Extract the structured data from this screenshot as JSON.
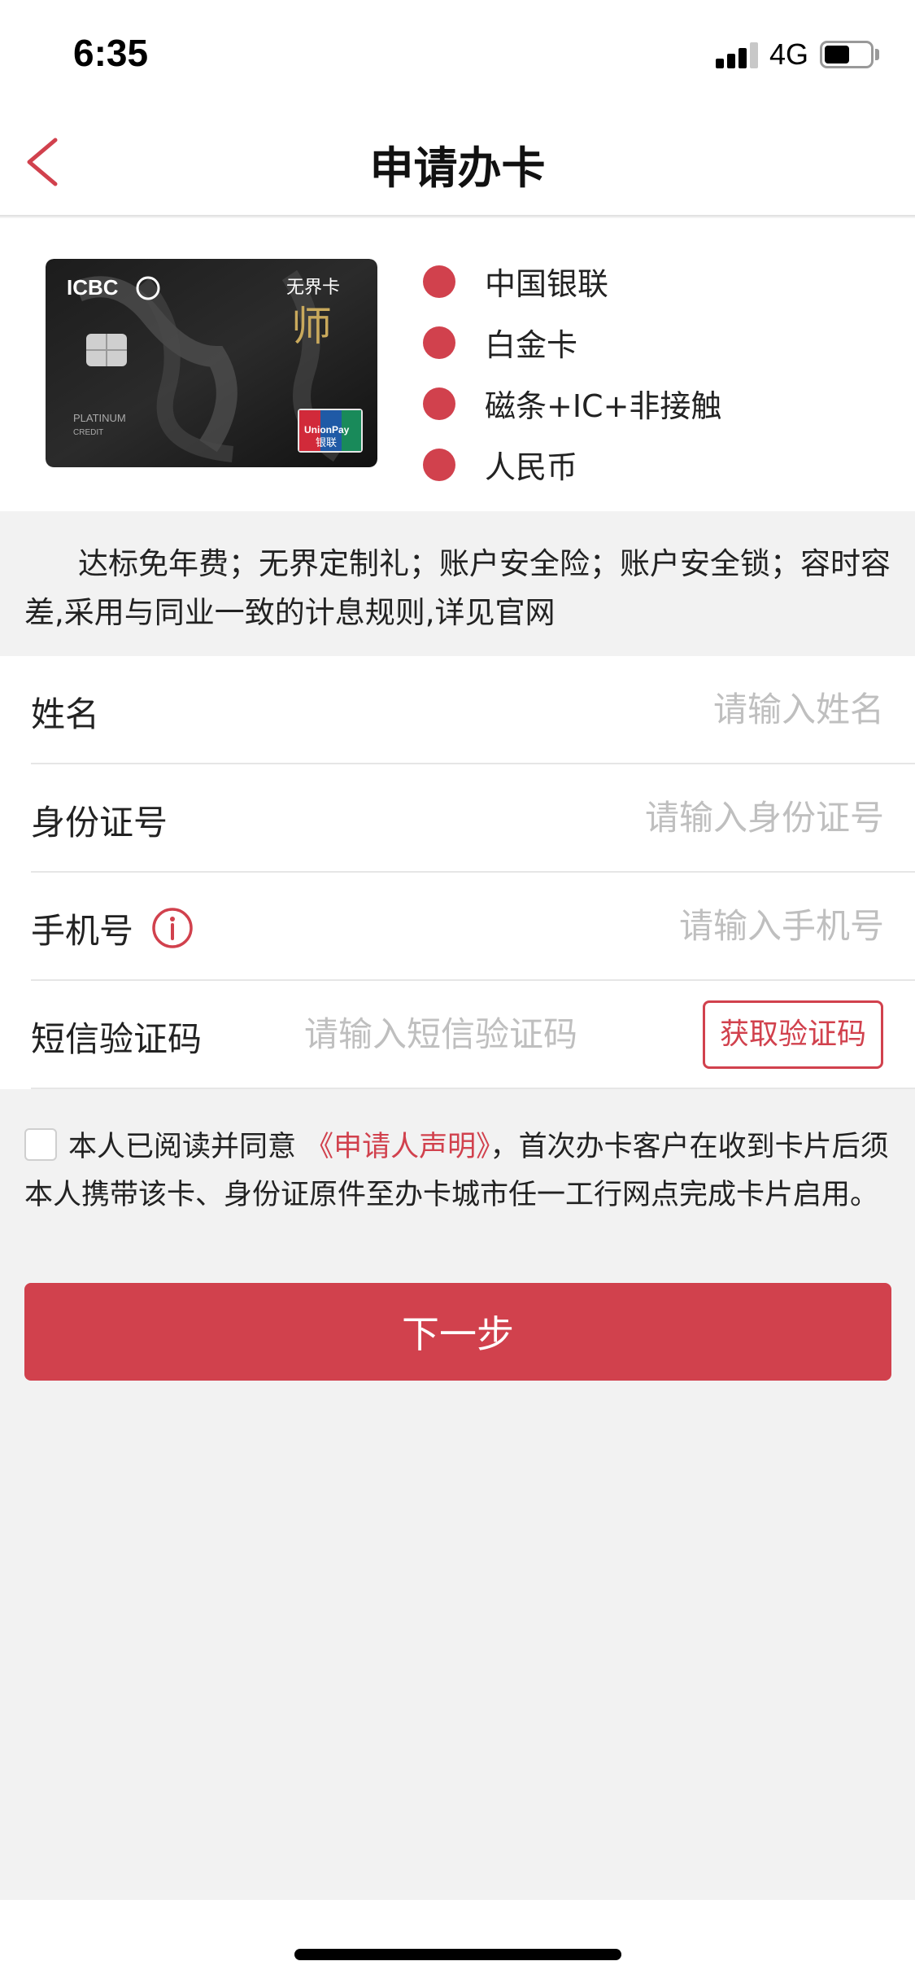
{
  "status_bar": {
    "time": "6:35",
    "network": "4G"
  },
  "nav": {
    "title": "申请办卡",
    "back_icon": "chevron-left-icon",
    "accent_color": "#d1414d"
  },
  "card": {
    "image_alt": "工行无界卡 白金卡",
    "features": [
      "中国银联",
      "白金卡",
      "磁条+IC+非接触",
      "人民币"
    ]
  },
  "description": "达标免年费；无界定制礼；账户安全险；账户安全锁；容时容差,采用与同业一致的计息规则,详见官网",
  "form": {
    "name": {
      "label": "姓名",
      "placeholder": "请输入姓名"
    },
    "id_number": {
      "label": "身份证号",
      "placeholder": "请输入身份证号"
    },
    "phone": {
      "label": "手机号",
      "placeholder": "请输入手机号",
      "info_icon": "info-icon"
    },
    "sms_code": {
      "label": "短信验证码",
      "placeholder": "请输入短信验证码",
      "button": "获取验证码"
    }
  },
  "agreement": {
    "prefix": "本人已阅读并同意",
    "link": "《申请人声明》",
    "suffix": "，首次办卡客户在收到卡片后须本人携带该卡、身份证原件至办卡城市任一工行网点完成卡片启用。"
  },
  "next_button": "下一步"
}
